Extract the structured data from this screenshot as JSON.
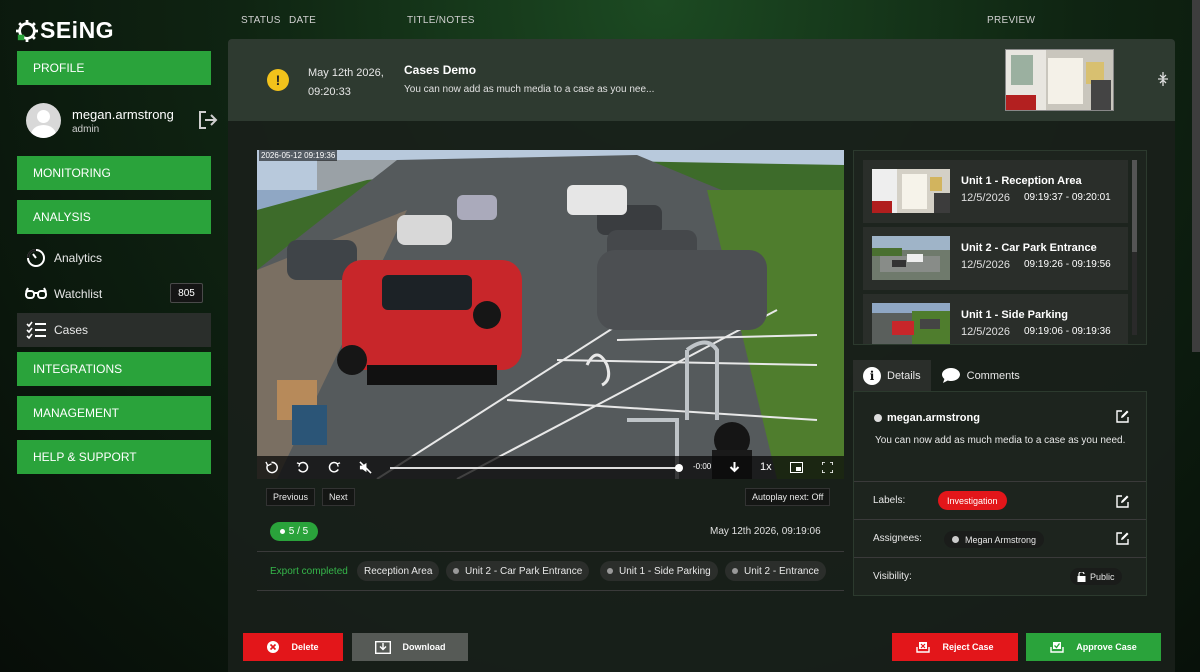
{
  "brand": {
    "name": "SEiNG"
  },
  "sidebar": {
    "profile_label": "PROFILE",
    "user": {
      "name": "megan.armstrong",
      "role": "admin"
    },
    "monitoring_label": "MONITORING",
    "analysis_label": "ANALYSIS",
    "sub_items": [
      {
        "label": "Analytics",
        "icon": "dashboard-icon"
      },
      {
        "label": "Watchlist",
        "icon": "glasses-icon",
        "badge": "805"
      },
      {
        "label": "Cases",
        "icon": "checklist-icon"
      }
    ],
    "integrations_label": "INTEGRATIONS",
    "management_label": "MANAGEMENT",
    "help_label": "HELP & SUPPORT"
  },
  "header": {
    "status": "STATUS",
    "date": "DATE",
    "title_notes": "TITLE/NOTES",
    "preview": "PREVIEW"
  },
  "case": {
    "status_icon": "warning-icon",
    "date_line1": "May 12th 2026,",
    "date_line2": "09:20:33",
    "title": "Cases Demo",
    "note": "You can now add as much media to a case as you nee..."
  },
  "player": {
    "timestamp": "2026-05-12 09:19:36",
    "time_left": "-0:00",
    "speed": "1x",
    "progress": 1.0,
    "previous_label": "Previous",
    "next_label": "Next",
    "autoplay_label": "Autoplay next: Off",
    "count_label": "5 / 5",
    "recorded_date": "May 12th 2026, 09:19:06"
  },
  "export": {
    "status": "Export completed",
    "chips": [
      "Reception Area",
      "Unit 2 - Car Park Entrance",
      "Unit 1 - Side Parking",
      "Unit 2 - Entrance"
    ]
  },
  "media_list": [
    {
      "title": "Unit 1 - Reception Area",
      "date": "12/5/2026",
      "time": "09:19:37 - 09:20:01"
    },
    {
      "title": "Unit 2 - Car Park Entrance",
      "date": "12/5/2026",
      "time": "09:19:26 - 09:19:56"
    },
    {
      "title": "Unit 1 - Side Parking",
      "date": "12/5/2026",
      "time": "09:19:06 - 09:19:36"
    }
  ],
  "tabs": {
    "details": "Details",
    "comments": "Comments"
  },
  "details": {
    "author": "megan.armstrong",
    "note": "You can now add as much media to a case as you need.",
    "labels_label": "Labels:",
    "label_value": "Investigation",
    "assignees_label": "Assignees:",
    "assignee": "Megan Armstrong",
    "visibility_label": "Visibility:",
    "visibility_value": "Public"
  },
  "actions": {
    "delete": "Delete",
    "download": "Download",
    "reject": "Reject Case",
    "approve": "Approve Case"
  },
  "colors": {
    "accent_green": "#2aa33b",
    "danger_red": "#e3161a",
    "warning_yellow": "#f2c21b"
  }
}
